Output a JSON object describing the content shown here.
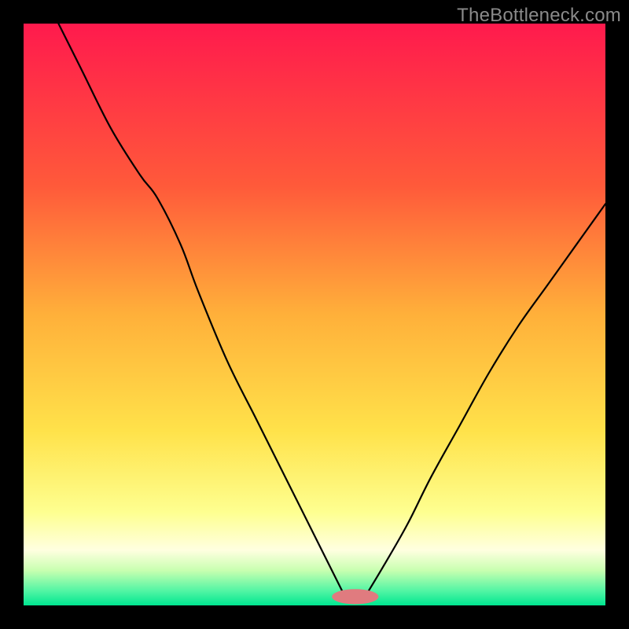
{
  "watermark": "TheBottleneck.com",
  "chart_data": {
    "type": "line",
    "title": "",
    "xlabel": "",
    "ylabel": "",
    "xlim": [
      0,
      100
    ],
    "ylim": [
      0,
      100
    ],
    "background_gradient": {
      "stops": [
        {
          "offset": 0.0,
          "color": "#ff1a4d"
        },
        {
          "offset": 0.28,
          "color": "#ff5a3a"
        },
        {
          "offset": 0.5,
          "color": "#ffb03a"
        },
        {
          "offset": 0.7,
          "color": "#ffe24a"
        },
        {
          "offset": 0.84,
          "color": "#feff90"
        },
        {
          "offset": 0.905,
          "color": "#ffffe0"
        },
        {
          "offset": 0.94,
          "color": "#c8ffb0"
        },
        {
          "offset": 0.975,
          "color": "#52f5a4"
        },
        {
          "offset": 1.0,
          "color": "#00e690"
        }
      ]
    },
    "series": [
      {
        "name": "left-curve",
        "x": [
          6,
          10,
          15,
          20,
          23,
          27,
          30,
          35,
          40,
          45,
          50,
          53,
          55
        ],
        "y": [
          100,
          92,
          82,
          74,
          70,
          62,
          54,
          42,
          32,
          22,
          12,
          6,
          2
        ]
      },
      {
        "name": "right-curve",
        "x": [
          59,
          62,
          66,
          70,
          75,
          80,
          85,
          90,
          95,
          100
        ],
        "y": [
          2,
          7,
          14,
          22,
          31,
          40,
          48,
          55,
          62,
          69
        ]
      }
    ],
    "marker": {
      "name": "bottom-pill",
      "cx": 57,
      "cy": 1.5,
      "rx": 4,
      "ry": 1.3,
      "color": "#e07b7f"
    }
  }
}
